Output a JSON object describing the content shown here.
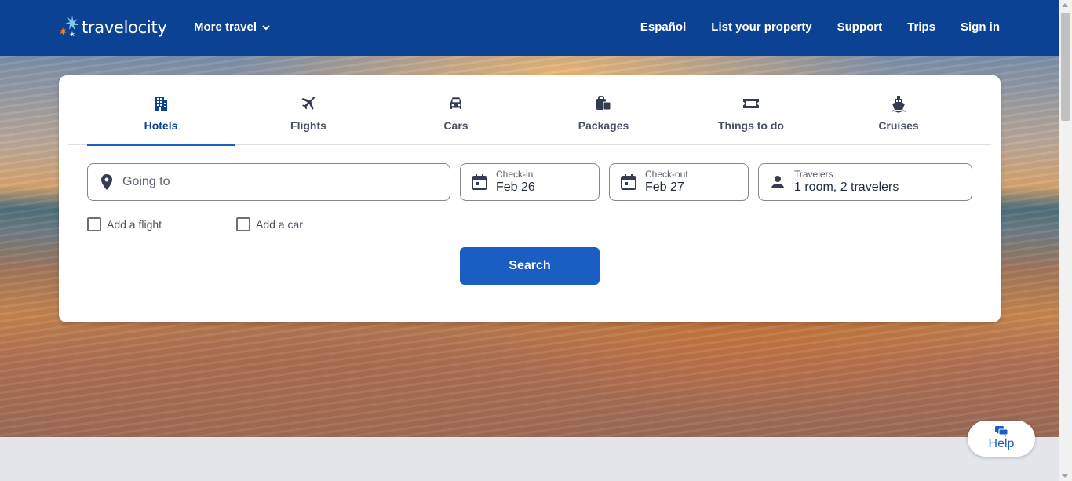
{
  "header": {
    "logo_text": "travelocity",
    "more_travel": "More travel",
    "nav": [
      "Español",
      "List your property",
      "Support",
      "Trips",
      "Sign in"
    ]
  },
  "tabs": [
    {
      "label": "Hotels",
      "icon": "building-icon",
      "active": true
    },
    {
      "label": "Flights",
      "icon": "airplane-icon",
      "active": false
    },
    {
      "label": "Cars",
      "icon": "car-icon",
      "active": false
    },
    {
      "label": "Packages",
      "icon": "packages-icon",
      "active": false
    },
    {
      "label": "Things to do",
      "icon": "ticket-icon",
      "active": false
    },
    {
      "label": "Cruises",
      "icon": "cruise-icon",
      "active": false
    }
  ],
  "search": {
    "going_to_placeholder": "Going to",
    "checkin_label": "Check-in",
    "checkin_value": "Feb 26",
    "checkout_label": "Check-out",
    "checkout_value": "Feb 27",
    "travelers_label": "Travelers",
    "travelers_value": "1 room, 2 travelers",
    "add_flight": "Add a flight",
    "add_car": "Add a car",
    "button": "Search"
  },
  "help": {
    "label": "Help"
  },
  "colors": {
    "brand": "#0b4293",
    "accent": "#1a5ec4",
    "logo_orange": "#f47b20",
    "logo_blue": "#5fb6e6"
  }
}
